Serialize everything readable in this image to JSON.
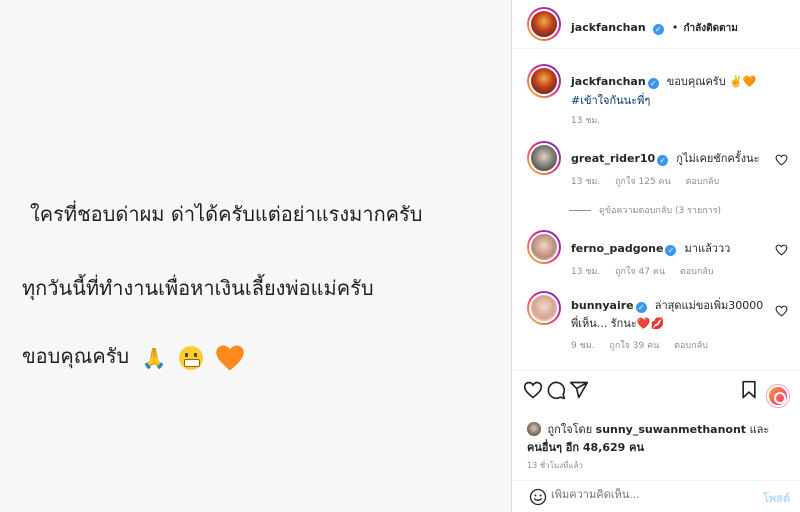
{
  "post_image": {
    "line1": "ใครที่ชอบด่าผม ด่าได้ครับแต่อย่าแรงมากครับ",
    "line2": "ทุกวันนี้ที่ทำงานเพื่อหาเงินเลี้ยงพ่อแม่ครับ",
    "line3": "ขอบคุณครับ"
  },
  "header": {
    "username": "jackfanchan",
    "separator": "•",
    "follow_status": "กำลังติดตาม"
  },
  "caption": {
    "username": "jackfanchan",
    "text": "ขอบคุณครับ ✌️🧡",
    "hashtag": "#เข้าใจกันนะพี่ๆ",
    "time": "13 ชม."
  },
  "comments": [
    {
      "username": "great_rider10",
      "text": "กูไม่เคยชักครั้งนะ",
      "time": "13 ชม.",
      "likes": "ถูกใจ 125 คน",
      "reply": "ตอบกลับ"
    },
    {
      "username": "ferno_padgone",
      "text": "มาแล้ววว",
      "time": "13 ชม.",
      "likes": "ถูกใจ 47 คน",
      "reply": "ตอบกลับ"
    },
    {
      "username": "bunnyaire",
      "text": "ล่าสุดแม่ขอเพิ่ม30000 พี่เห็น... รักนะ❤️💋",
      "time": "9 ชม.",
      "likes": "ถูกใจ 39 คน",
      "reply": "ตอบกลับ"
    }
  ],
  "view_replies": "ดูข้อความตอบกลับ (3 รายการ)",
  "liked_by": {
    "prefix": "ถูกใจโดย",
    "user": "sunny_suwanmethanont",
    "and": "และ",
    "others": "คนอื่นๆ อีก 48,629 คน"
  },
  "time_ago": "13 ชั่วโมงที่แล้ว",
  "comment_box": {
    "placeholder": "เพิ่มความคิดเห็น...",
    "post_label": "โพสต์"
  },
  "icons": {
    "like": "heart-icon",
    "comment": "comment-icon",
    "share": "share-icon",
    "save": "bookmark-icon",
    "emoji": "emoji-icon"
  },
  "colors": {
    "verified": "#3897f0",
    "link": "#00376b",
    "muted": "#8e8e8e",
    "post_button": "#b2dffc"
  }
}
